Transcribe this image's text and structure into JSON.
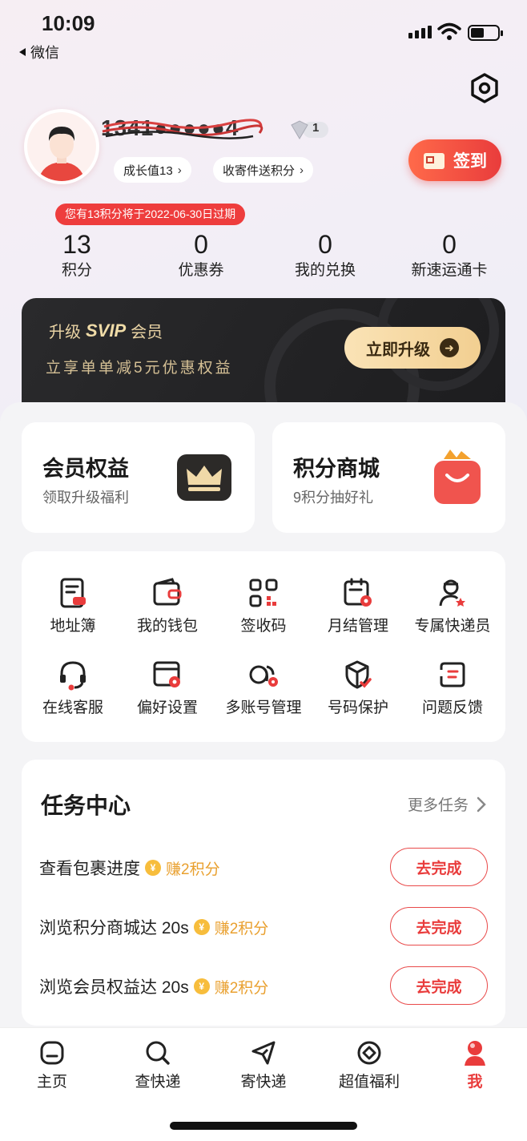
{
  "status_bar": {
    "time": "10:09",
    "back_label": "微信"
  },
  "profile": {
    "name_masked": "1341●●●●●4",
    "level": "1",
    "growth_pill": "成长值13",
    "points_pill": "收寄件送积分",
    "signin_label": "签到",
    "expire_notice": "您有13积分将于2022-06-30日过期"
  },
  "stats": [
    {
      "value": "13",
      "label": "积分"
    },
    {
      "value": "0",
      "label": "优惠券"
    },
    {
      "value": "0",
      "label": "我的兑换"
    },
    {
      "value": "0",
      "label": "新速运通卡"
    }
  ],
  "svip": {
    "prefix": "升级",
    "tag": "SVIP",
    "suffix": "会员",
    "subtitle": "立享单单减5元优惠权益",
    "button": "立即升级"
  },
  "feature_cards": [
    {
      "title": "会员权益",
      "subtitle": "领取升级福利",
      "icon": "crown-icon"
    },
    {
      "title": "积分商城",
      "subtitle": "9积分抽好礼",
      "icon": "shopping-bag-icon"
    }
  ],
  "services": [
    {
      "label": "地址簿",
      "icon": "address-book-icon"
    },
    {
      "label": "我的钱包",
      "icon": "wallet-icon"
    },
    {
      "label": "签收码",
      "icon": "qr-code-icon"
    },
    {
      "label": "月结管理",
      "icon": "calendar-icon"
    },
    {
      "label": "专属快递员",
      "icon": "courier-icon"
    },
    {
      "label": "在线客服",
      "icon": "headset-icon"
    },
    {
      "label": "偏好设置",
      "icon": "preferences-icon"
    },
    {
      "label": "多账号管理",
      "icon": "multi-account-icon"
    },
    {
      "label": "号码保护",
      "icon": "shield-icon"
    },
    {
      "label": "问题反馈",
      "icon": "feedback-icon"
    }
  ],
  "tasks": {
    "title": "任务中心",
    "more": "更多任务",
    "items": [
      {
        "name": "查看包裹进度",
        "reward": "赚2积分",
        "button": "去完成"
      },
      {
        "name": "浏览积分商城达 20s",
        "reward": "赚2积分",
        "button": "去完成"
      },
      {
        "name": "浏览会员权益达 20s",
        "reward": "赚2积分",
        "button": "去完成"
      }
    ]
  },
  "tabbar": [
    {
      "label": "主页",
      "icon": "home-icon"
    },
    {
      "label": "查快递",
      "icon": "search-icon"
    },
    {
      "label": "寄快递",
      "icon": "send-icon"
    },
    {
      "label": "超值福利",
      "icon": "benefits-icon"
    },
    {
      "label": "我",
      "icon": "profile-icon",
      "active": true
    }
  ],
  "colors": {
    "accent": "#e93c3c",
    "gold": "#e9a02f",
    "svip_bg": "#1f1f21"
  }
}
